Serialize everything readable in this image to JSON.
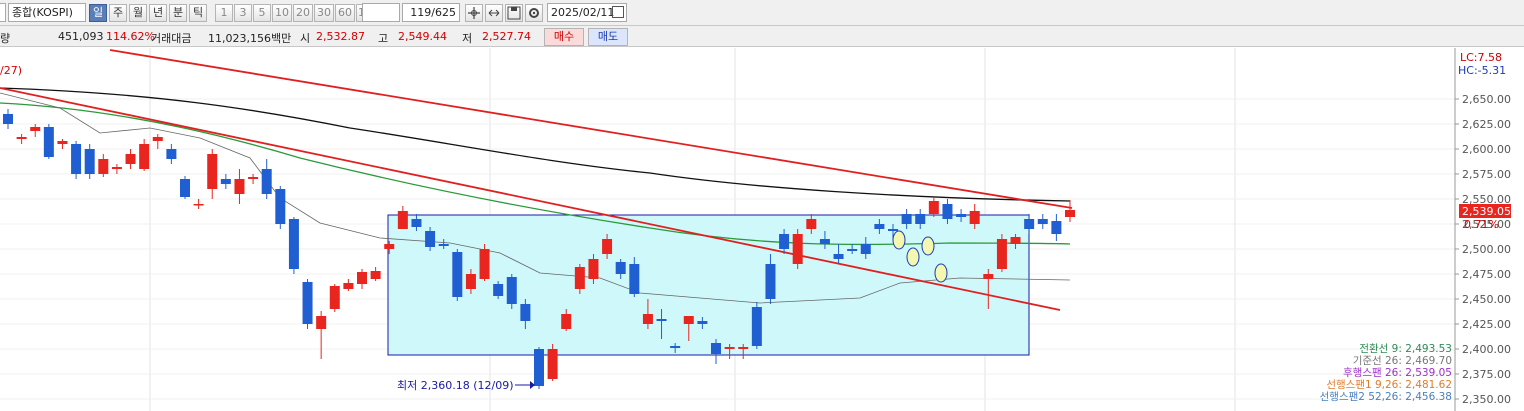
{
  "toolbar": {
    "market": "종합(KOSPI)",
    "periods": [
      "일",
      "주",
      "월",
      "년",
      "분",
      "틱"
    ],
    "active_period": "일",
    "numbers": [
      "1",
      "3",
      "5",
      "10",
      "20",
      "30",
      "60",
      "120"
    ],
    "count": "119/625",
    "date": "2025/02/11"
  },
  "info": {
    "vol_label": "량",
    "volume": "451,093",
    "volume_rate": "114.62%",
    "amount_label": "거래대금",
    "amount": "11,023,156백만",
    "open_label": "시",
    "open": "2,532.87",
    "high_label": "고",
    "high": "2,549.44",
    "low_label": "저",
    "low": "2,527.74",
    "buy_label": "매수",
    "sell_label": "매도"
  },
  "axis": {
    "ticks": [
      "2,650.00",
      "2,625.00",
      "2,600.00",
      "2,575.00",
      "2,550.00",
      "2,525.00",
      "2,500.00",
      "2,475.00",
      "2,450.00",
      "2,425.00",
      "2,400.00",
      "2,375.00",
      "2,350.00"
    ],
    "lc": "LC:7.58",
    "hc": "HC:-5.31",
    "price_tag": "2,539.05",
    "pct_tag": "0.71%"
  },
  "chart_labels": {
    "top_left": "/27)",
    "min_label": "최저 2,360.18 (12/09)"
  },
  "legend": [
    {
      "text": "전환선 9: 2,493.53",
      "color": "#2e8b57"
    },
    {
      "text": "기준선 26: 2,469.70",
      "color": "#777777"
    },
    {
      "text": "후행스팬 26: 2,539.05",
      "color": "#9b30c8"
    },
    {
      "text": "선행스팬1 9,26: 2,481.62",
      "color": "#e07b2a"
    },
    {
      "text": "선행스팬2 52,26: 2,456.38",
      "color": "#4a7fc1"
    }
  ],
  "colors": {
    "up": "#e8251f",
    "down": "#1f5fd1",
    "box_fill": "#cff8fb",
    "box_edge": "#1a1aa8"
  },
  "chart_data": {
    "type": "candlestick",
    "ylim": [
      2340,
      2700
    ],
    "candles": [
      [
        2635,
        2640,
        2620,
        2625
      ],
      [
        2610,
        2615,
        2605,
        2612
      ],
      [
        2618,
        2625,
        2612,
        2622
      ],
      [
        2622,
        2625,
        2590,
        2592
      ],
      [
        2605,
        2610,
        2600,
        2608
      ],
      [
        2605,
        2608,
        2570,
        2575
      ],
      [
        2600,
        2605,
        2570,
        2575
      ],
      [
        2575,
        2595,
        2572,
        2590
      ],
      [
        2580,
        2585,
        2575,
        2582
      ],
      [
        2585,
        2600,
        2580,
        2595
      ],
      [
        2580,
        2610,
        2578,
        2605
      ],
      [
        2608,
        2615,
        2600,
        2612
      ],
      [
        2600,
        2605,
        2585,
        2590
      ],
      [
        2570,
        2573,
        2550,
        2552
      ],
      [
        2545,
        2550,
        2540,
        2545
      ],
      [
        2560,
        2600,
        2550,
        2595
      ],
      [
        2570,
        2575,
        2560,
        2565
      ],
      [
        2555,
        2580,
        2545,
        2570
      ],
      [
        2570,
        2575,
        2565,
        2572
      ],
      [
        2580,
        2590,
        2550,
        2555
      ],
      [
        2560,
        2563,
        2520,
        2525
      ],
      [
        2530,
        2532,
        2475,
        2480
      ],
      [
        2467,
        2470,
        2420,
        2425
      ],
      [
        2420,
        2438,
        2390,
        2433
      ],
      [
        2440,
        2465,
        2437,
        2463
      ],
      [
        2460,
        2470,
        2458,
        2466
      ],
      [
        2465,
        2480,
        2460,
        2477
      ],
      [
        2470,
        2482,
        2468,
        2478
      ],
      [
        2500,
        2508,
        2495,
        2505
      ],
      [
        2520,
        2543,
        2520,
        2538
      ],
      [
        2530,
        2535,
        2518,
        2522
      ],
      [
        2518,
        2522,
        2498,
        2502
      ],
      [
        2505,
        2510,
        2500,
        2503
      ],
      [
        2497,
        2500,
        2448,
        2452
      ],
      [
        2460,
        2480,
        2455,
        2475
      ],
      [
        2470,
        2505,
        2468,
        2500
      ],
      [
        2465,
        2468,
        2450,
        2453
      ],
      [
        2472,
        2475,
        2440,
        2445
      ],
      [
        2445,
        2450,
        2420,
        2428
      ],
      [
        2400,
        2402,
        2360,
        2363
      ],
      [
        2370,
        2405,
        2368,
        2400
      ],
      [
        2420,
        2440,
        2418,
        2435
      ],
      [
        2460,
        2485,
        2455,
        2482
      ],
      [
        2470,
        2495,
        2465,
        2490
      ],
      [
        2495,
        2515,
        2490,
        2510
      ],
      [
        2487,
        2490,
        2470,
        2475
      ],
      [
        2485,
        2492,
        2452,
        2455
      ],
      [
        2425,
        2450,
        2420,
        2435
      ],
      [
        2430,
        2440,
        2410,
        2428
      ],
      [
        2403,
        2406,
        2396,
        2401
      ],
      [
        2425,
        2430,
        2408,
        2433
      ],
      [
        2428,
        2432,
        2420,
        2425
      ],
      [
        2406,
        2410,
        2385,
        2395
      ],
      [
        2400,
        2405,
        2390,
        2402
      ],
      [
        2400,
        2405,
        2390,
        2402
      ],
      [
        2442,
        2447,
        2400,
        2403
      ],
      [
        2485,
        2495,
        2445,
        2450
      ],
      [
        2515,
        2520,
        2495,
        2500
      ],
      [
        2485,
        2520,
        2480,
        2515
      ],
      [
        2520,
        2535,
        2515,
        2530
      ],
      [
        2510,
        2518,
        2500,
        2505
      ],
      [
        2495,
        2505,
        2485,
        2490
      ],
      [
        2500,
        2505,
        2495,
        2498
      ],
      [
        2505,
        2512,
        2490,
        2495
      ],
      [
        2525,
        2530,
        2515,
        2520
      ],
      [
        2520,
        2525,
        2510,
        2518
      ],
      [
        2535,
        2540,
        2520,
        2525
      ],
      [
        2535,
        2540,
        2520,
        2525
      ],
      [
        2535,
        2552,
        2532,
        2548
      ],
      [
        2545,
        2550,
        2525,
        2530
      ],
      [
        2535,
        2540,
        2527,
        2532
      ],
      [
        2525,
        2545,
        2520,
        2538
      ],
      [
        2470,
        2480,
        2440,
        2475
      ],
      [
        2480,
        2515,
        2477,
        2510
      ],
      [
        2505,
        2515,
        2500,
        2512
      ],
      [
        2530,
        2535,
        2515,
        2520
      ],
      [
        2530,
        2535,
        2520,
        2525
      ],
      [
        2528,
        2535,
        2508,
        2515
      ],
      [
        2532,
        2549,
        2527,
        2539
      ]
    ]
  }
}
